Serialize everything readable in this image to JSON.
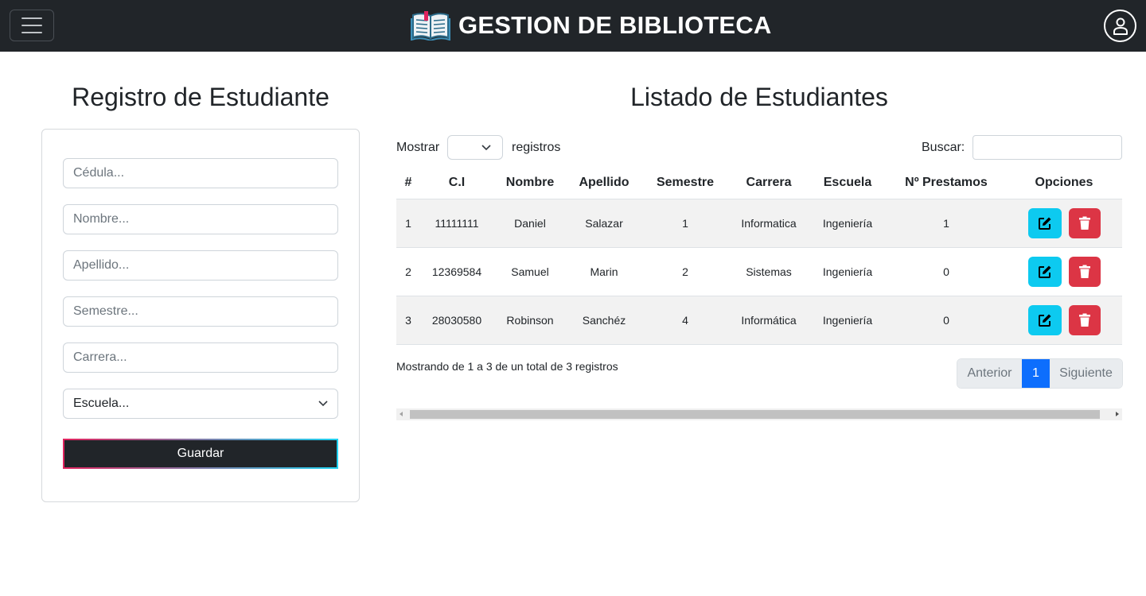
{
  "navbar": {
    "title": "GESTION DE BIBLIOTECA",
    "brand_icon": "open-book-icon",
    "menu_icon": "hamburger-icon",
    "user_icon": "user-icon",
    "bg_color": "#212529"
  },
  "form": {
    "heading": "Registro de Estudiante",
    "cedula_placeholder": "Cédula...",
    "nombre_placeholder": "Nombre...",
    "apellido_placeholder": "Apellido...",
    "semestre_placeholder": "Semestre...",
    "carrera_placeholder": "Carrera...",
    "escuela_selected": "Escuela...",
    "save_label": "Guardar"
  },
  "list": {
    "heading": "Listado de Estudiantes",
    "show_label": "Mostrar",
    "records_label": "registros",
    "page_length_selected": "",
    "search_label": "Buscar:",
    "search_value": "",
    "columns": [
      "#",
      "C.I",
      "Nombre",
      "Apellido",
      "Semestre",
      "Carrera",
      "Escuela",
      "Nº Prestamos",
      "Opciones"
    ],
    "rows": [
      [
        "1",
        "11111111",
        "Daniel",
        "Salazar",
        "1",
        "Informatica",
        "Ingeniería",
        "1"
      ],
      [
        "2",
        "12369584",
        "Samuel",
        "Marin",
        "2",
        "Sistemas",
        "Ingeniería",
        "0"
      ],
      [
        "3",
        "28030580",
        "Robinson",
        "Sanchéz",
        "4",
        "Informática",
        "Ingeniería",
        "0"
      ]
    ],
    "info": "Mostrando de 1 a 3 de un total de 3 registros",
    "pagination": {
      "prev": "Anterior",
      "current": "1",
      "next": "Siguiente"
    },
    "edit_icon": "edit-icon",
    "delete_icon": "trash-icon",
    "edit_color": "#0dcaf0",
    "delete_color": "#dc3545",
    "active_page_color": "#0d6efd"
  }
}
